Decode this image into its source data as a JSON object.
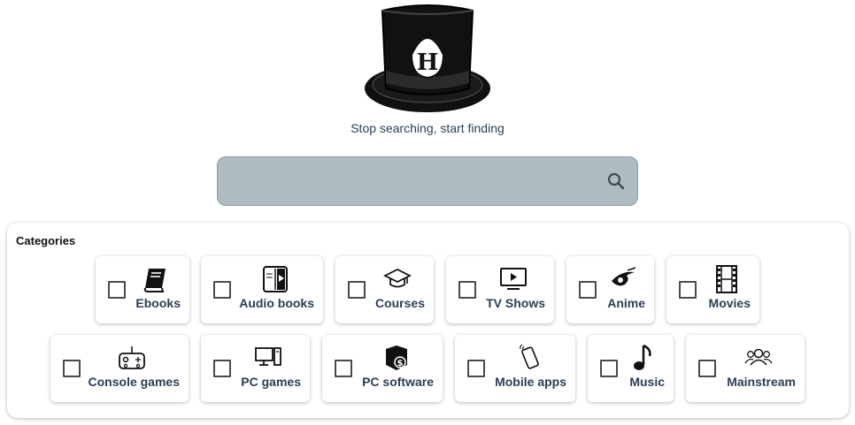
{
  "brand": {
    "logo_letter": "H",
    "tagline": "Stop searching, start finding"
  },
  "search": {
    "value": "",
    "placeholder": "",
    "icon": "search-icon"
  },
  "categories": {
    "title": "Categories",
    "row1": [
      {
        "label": "Ebooks",
        "icon": "book-icon",
        "checked": false
      },
      {
        "label": "Audio books",
        "icon": "audiobook-icon",
        "checked": false
      },
      {
        "label": "Courses",
        "icon": "graduation-cap-icon",
        "checked": false
      },
      {
        "label": "TV Shows",
        "icon": "tv-icon",
        "checked": false
      },
      {
        "label": "Anime",
        "icon": "anime-eye-icon",
        "checked": false
      },
      {
        "label": "Movies",
        "icon": "film-strip-icon",
        "checked": false
      }
    ],
    "row2": [
      {
        "label": "Console games",
        "icon": "gamepad-icon",
        "checked": false
      },
      {
        "label": "PC games",
        "icon": "desktop-pc-icon",
        "checked": false
      },
      {
        "label": "PC software",
        "icon": "software-box-icon",
        "checked": false
      },
      {
        "label": "Mobile apps",
        "icon": "mobile-phone-icon",
        "checked": false
      },
      {
        "label": "Music",
        "icon": "music-note-icon",
        "checked": false
      },
      {
        "label": "Mainstream",
        "icon": "people-group-icon",
        "checked": false
      }
    ]
  }
}
